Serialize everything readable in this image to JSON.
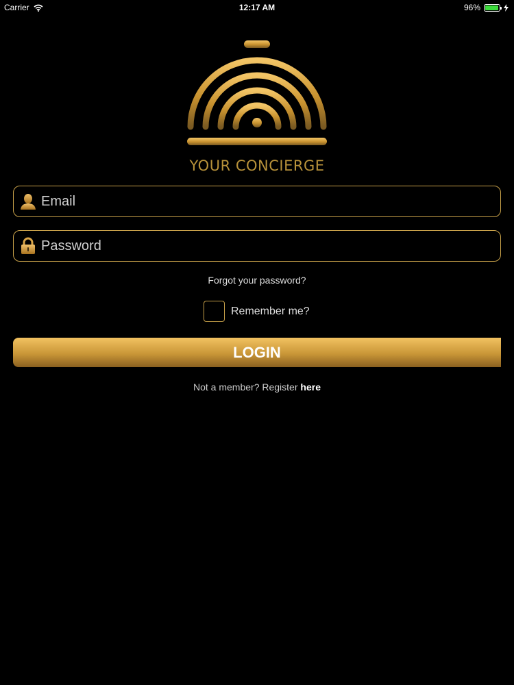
{
  "status_bar": {
    "carrier": "Carrier",
    "time": "12:17 AM",
    "battery": "96%",
    "battery_level": 0.96
  },
  "brand": {
    "name": "YOUR CONCIERGE",
    "accent_color": "#c9a24a"
  },
  "form": {
    "email_placeholder": "Email",
    "password_placeholder": "Password",
    "forgot_label": "Forgot your password?",
    "remember_label": "Remember me?",
    "login_label": "LOGIN",
    "register_prefix": "Not a member? Register",
    "register_link": "here"
  },
  "icons": {
    "email": "user-icon",
    "password": "lock-icon",
    "wifi": "wifi-icon",
    "battery": "battery-icon",
    "charging": "bolt-icon"
  }
}
